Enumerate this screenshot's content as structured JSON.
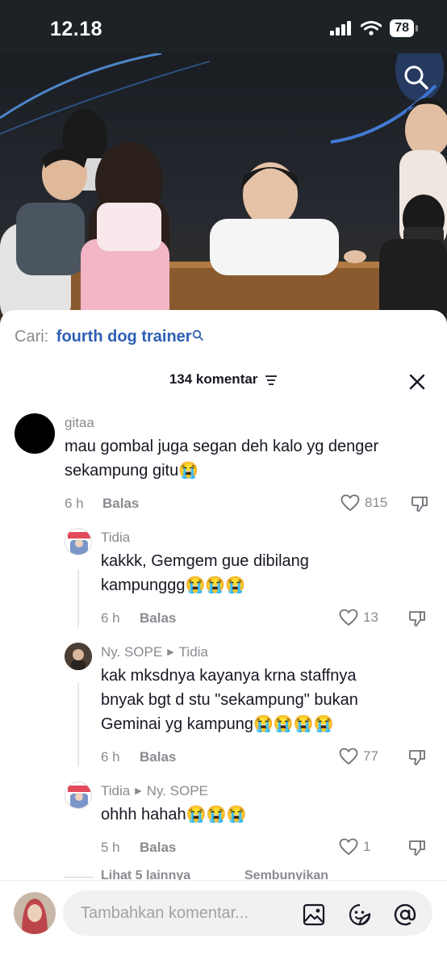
{
  "status_bar": {
    "time": "12.18",
    "battery": "78"
  },
  "search": {
    "prefix": "Cari:",
    "term": "fourth dog trainer"
  },
  "header": {
    "count_label": "134 komentar"
  },
  "comments": [
    {
      "user": "gitaa",
      "reply_to": "",
      "line1": "mau gombal juga segan deh kalo yg denger",
      "line2": "sekampung gitu😭",
      "line3": "",
      "time": "6 h",
      "reply_label": "Balas",
      "likes": "815"
    },
    {
      "user": "Tidia",
      "reply_to": "",
      "line1": "kakkk, Gemgem gue dibilang",
      "line2": "kampunggg😭😭😭",
      "line3": "",
      "time": "6 h",
      "reply_label": "Balas",
      "likes": "13"
    },
    {
      "user": "Ny. SOPE",
      "reply_to": "Tidia",
      "line1": "kak mksdnya kayanya krna staffnya",
      "line2": "bnyak bgt d stu \"sekampung\" bukan",
      "line3": "Geminai yg kampung😭😭😭😭",
      "time": "6 h",
      "reply_label": "Balas",
      "likes": "77"
    },
    {
      "user": "Tidia",
      "reply_to": "Ny. SOPE",
      "line1": "ohhh hahah😭😭😭",
      "line2": "",
      "line3": "",
      "time": "5 h",
      "reply_label": "Balas",
      "likes": "1"
    }
  ],
  "more": {
    "show_more": "Lihat 5 lainnya",
    "hide": "Sembunyikan"
  },
  "composer": {
    "placeholder": "Tambahkan komentar..."
  },
  "colors": {
    "link_blue": "#2d5fb4",
    "status_bg": "#1c2226",
    "muted": "#8a8b91"
  },
  "icons": [
    "search-icon",
    "sort-icon",
    "close-icon",
    "heart-icon",
    "dislike-icon",
    "image-icon",
    "sticker-icon",
    "mention-icon",
    "signal-icon",
    "wifi-icon"
  ]
}
